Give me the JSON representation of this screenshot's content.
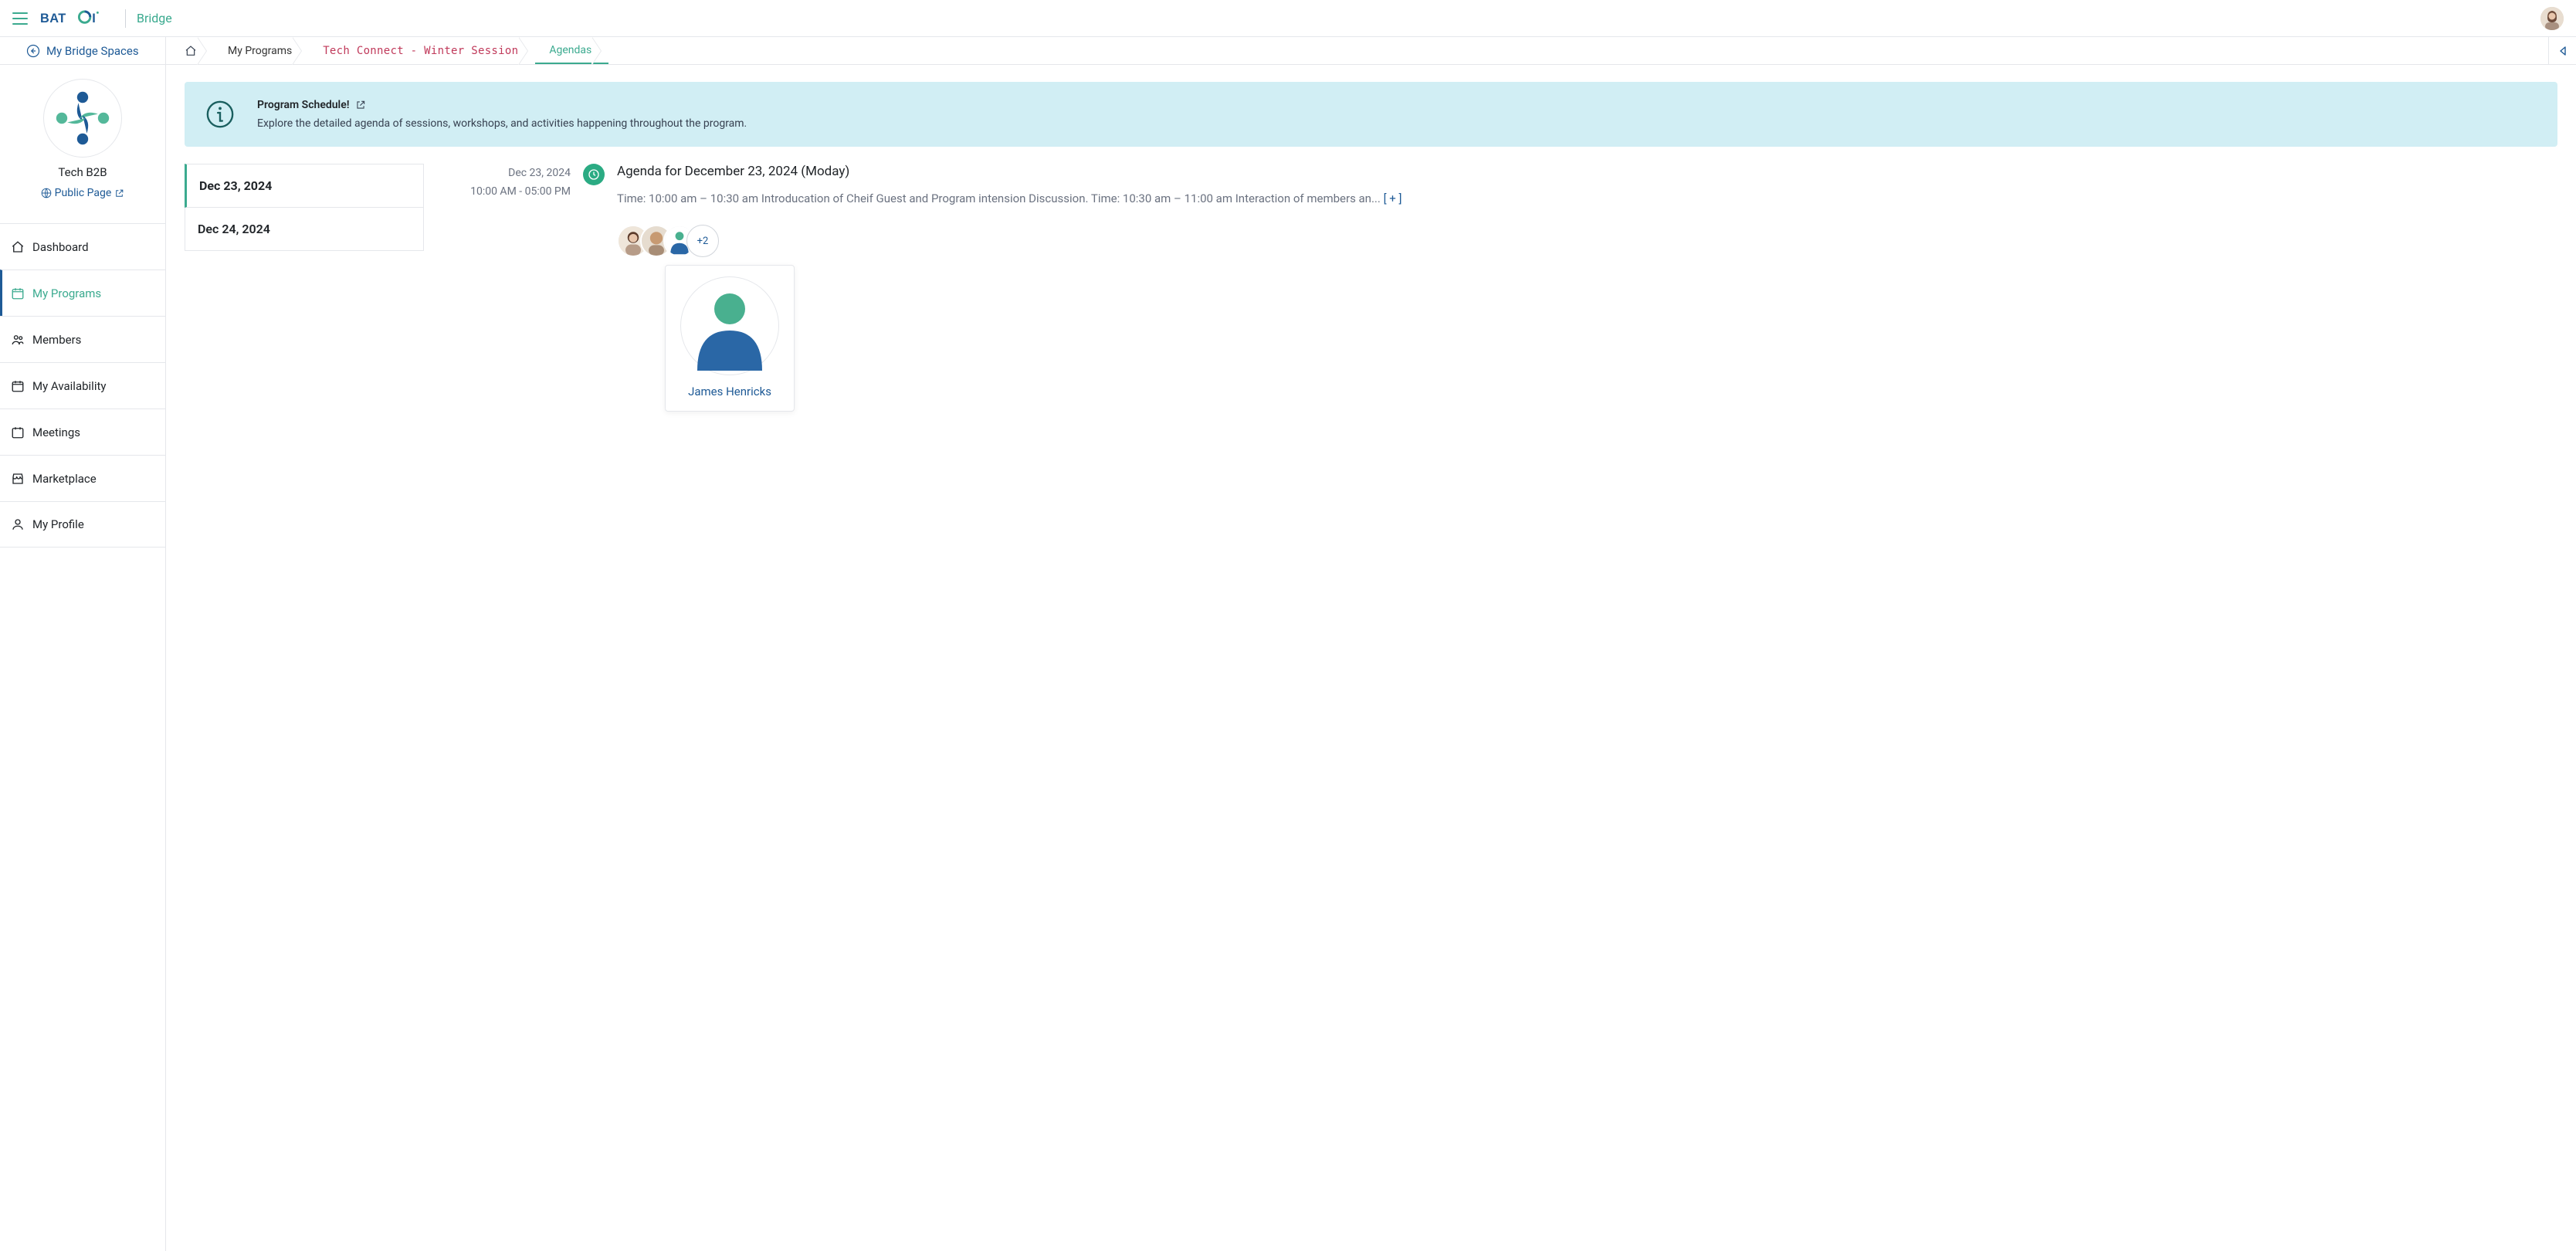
{
  "header": {
    "product": "Bridge",
    "logo_text": "BATOI"
  },
  "breadcrumb": {
    "back": "My Bridge Spaces",
    "my_programs": "My Programs",
    "program": "Tech Connect - Winter Session",
    "current": "Agendas"
  },
  "org": {
    "name": "Tech B2B",
    "public_page": "Public Page"
  },
  "sidebar": {
    "items": [
      {
        "label": "Dashboard"
      },
      {
        "label": "My Programs"
      },
      {
        "label": "Members"
      },
      {
        "label": "My Availability"
      },
      {
        "label": "Meetings"
      },
      {
        "label": "Marketplace"
      },
      {
        "label": "My Profile"
      }
    ]
  },
  "banner": {
    "title": "Program Schedule!",
    "desc": "Explore the detailed agenda of sessions, workshops, and activities happening throughout the program."
  },
  "dates": [
    {
      "label": "Dec 23, 2024"
    },
    {
      "label": "Dec 24, 2024"
    }
  ],
  "agenda": {
    "date_short": "Dec 23, 2024",
    "time_range": "10:00 AM - 05:00 PM",
    "title": "Agenda for December 23, 2024 (Moday)",
    "text": "Time: 10:00 am – 10:30 am Introducation of Cheif Guest and Program intension Discussion. Time: 10:30 am – 11:00 am Interaction of members an...",
    "expand": "[ + ]",
    "more_count": "+2"
  },
  "popover": {
    "name": "James Henricks"
  }
}
